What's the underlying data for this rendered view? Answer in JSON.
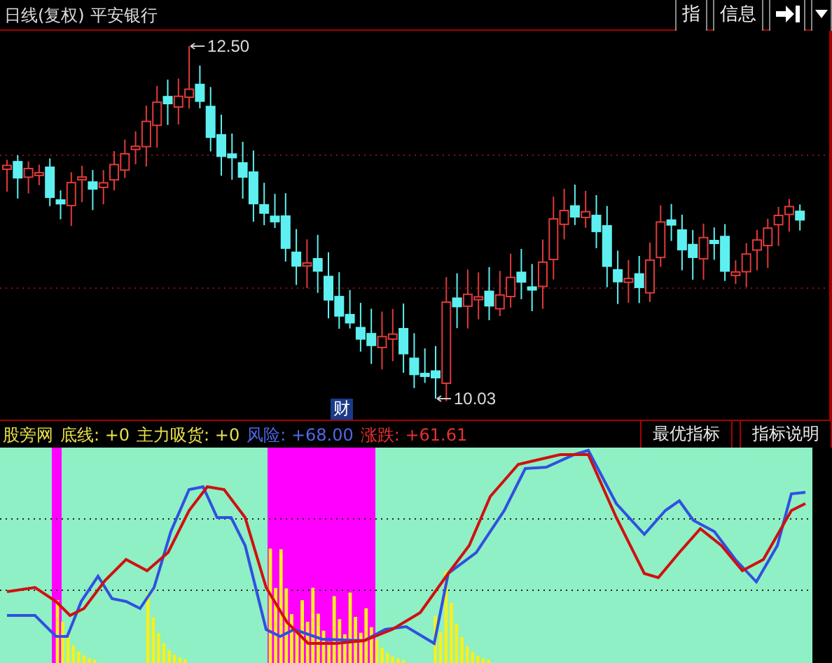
{
  "header": {
    "period": "日线(复权)",
    "stock": "平安银行",
    "buttons": [
      {
        "label": "指"
      },
      {
        "label": "信息"
      }
    ]
  },
  "price_chart": {
    "high_label": "12.50",
    "low_label": "10.03",
    "marker": "财"
  },
  "indicator": {
    "values": [
      {
        "text": "股旁网",
        "kind": "name"
      },
      {
        "text": "底线: +0",
        "kind": "name"
      },
      {
        "text": "主力吸货: +0",
        "kind": "name"
      },
      {
        "text": "风险: +68.00",
        "kind": "risk"
      },
      {
        "text": "涨跌: +61.61",
        "kind": "change"
      }
    ],
    "buttons": [
      {
        "label": "最优指标"
      },
      {
        "label": "指标说明"
      }
    ]
  }
}
